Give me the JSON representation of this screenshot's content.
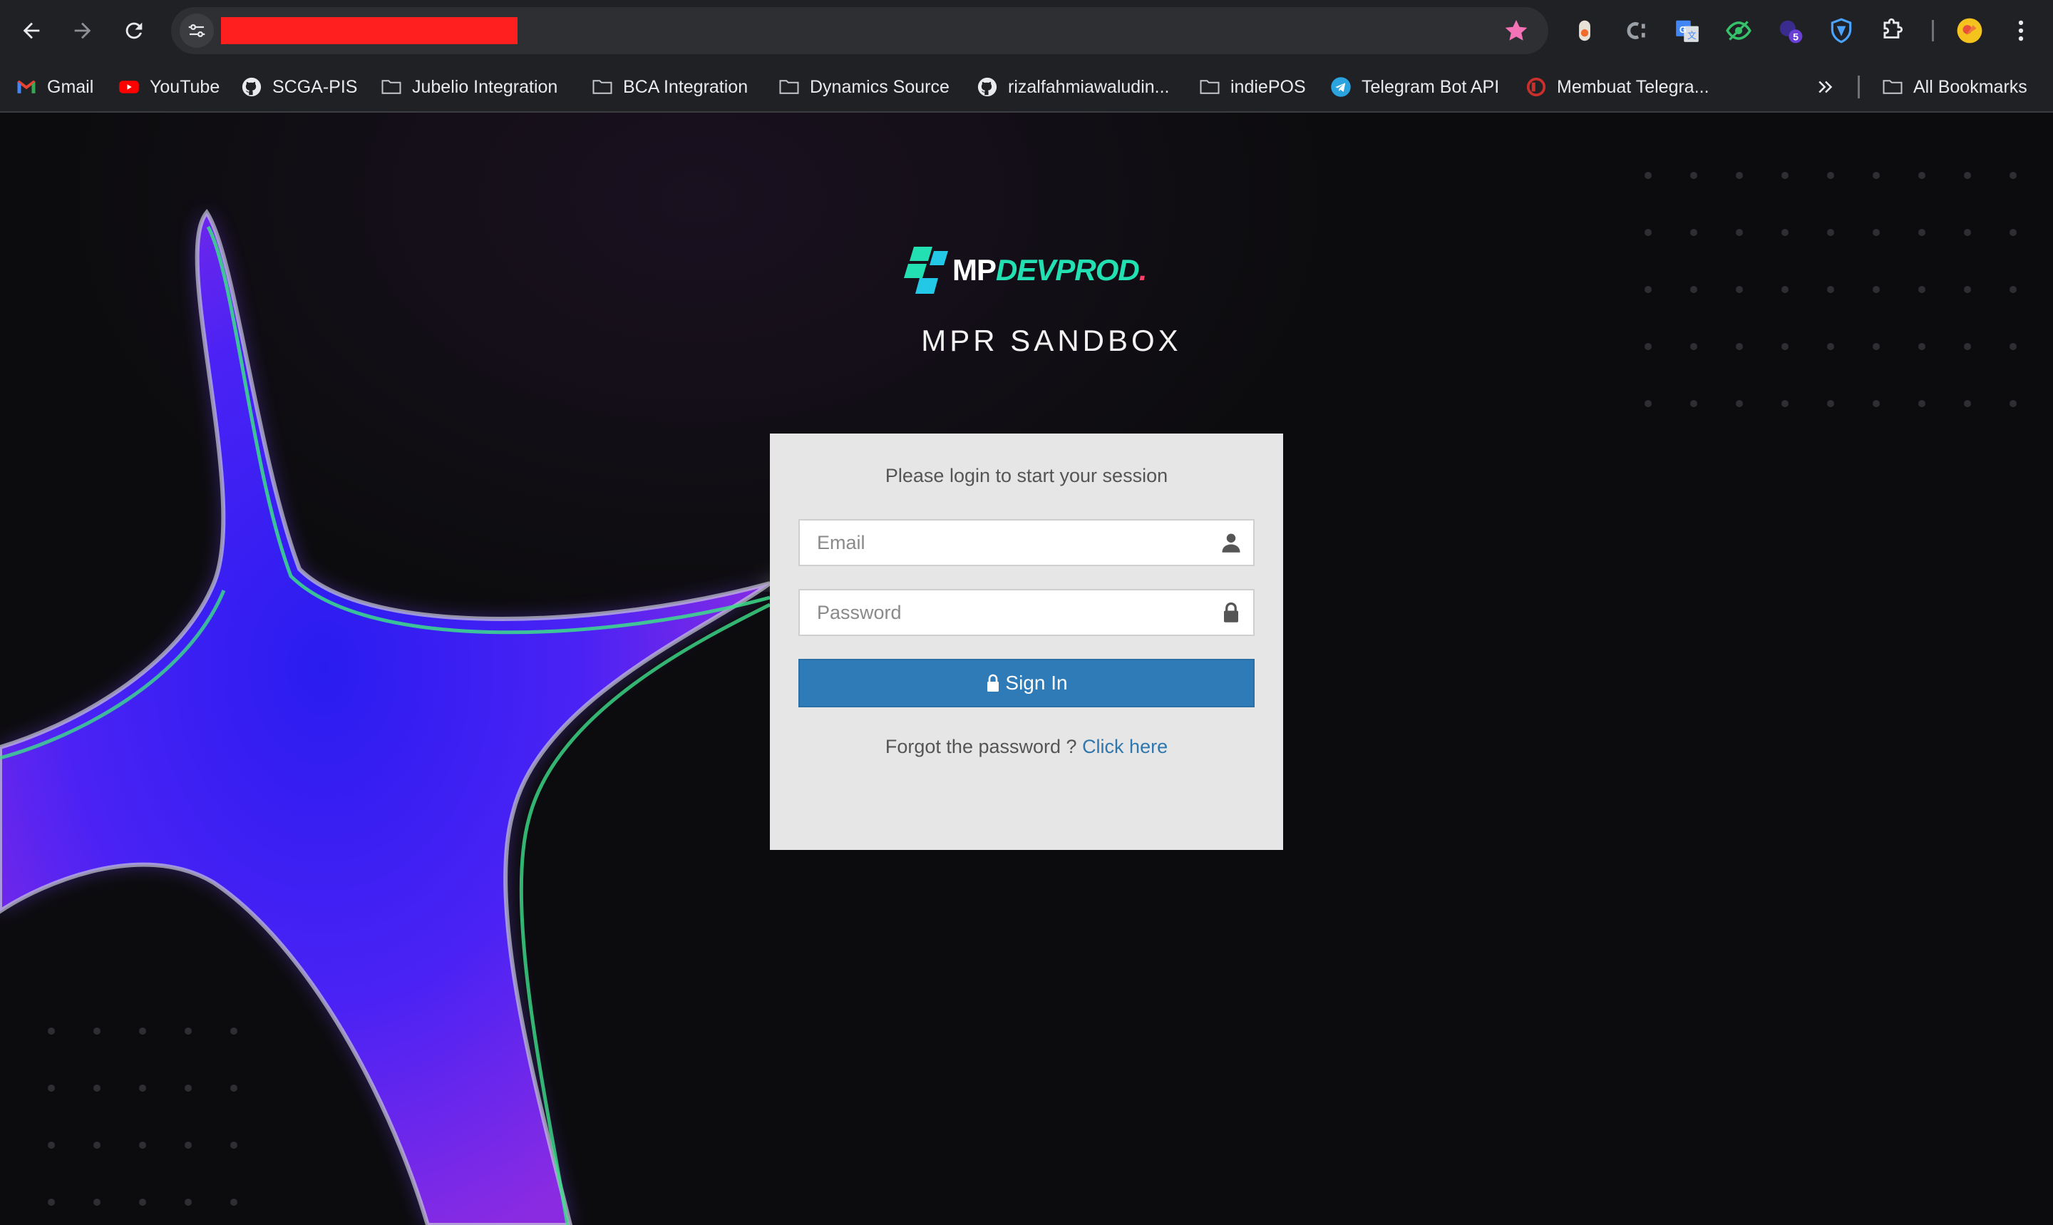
{
  "browser": {
    "back_icon": "arrow-left-icon",
    "forward_icon": "arrow-right-icon",
    "reload_icon": "reload-icon",
    "site_info_icon": "tune-icon",
    "bookmark_star_icon": "star-icon",
    "extensions": [
      "extension-orange-icon",
      "extension-c-icon",
      "google-translate-icon",
      "extension-eye-icon",
      "extension-badge-icon",
      "shield-icon",
      "puzzle-icon"
    ],
    "extension_badge_count": "5",
    "accent_star_color": "#f472b6"
  },
  "bookmarks": {
    "items": [
      {
        "label": "Gmail",
        "icon": "gmail-icon"
      },
      {
        "label": "YouTube",
        "icon": "youtube-icon"
      },
      {
        "label": "SCGA-PIS",
        "icon": "github-icon"
      },
      {
        "label": "Jubelio Integration",
        "icon": "folder-icon"
      },
      {
        "label": "BCA Integration",
        "icon": "folder-icon"
      },
      {
        "label": "Dynamics Source",
        "icon": "folder-icon"
      },
      {
        "label": "rizalfahmiawaludin...",
        "icon": "github-icon"
      },
      {
        "label": "indiePOS",
        "icon": "folder-icon"
      },
      {
        "label": "Telegram Bot API",
        "icon": "telegram-icon"
      },
      {
        "label": "Membuat Telegra...",
        "icon": "site-icon"
      }
    ],
    "overflow_icon": "chevron-double-right-icon",
    "all_bookmarks": "All Bookmarks"
  },
  "page": {
    "logo": {
      "mp": "MP",
      "dev": "DEVPROD",
      "dot": "."
    },
    "title": "MPR SANDBOX",
    "login": {
      "message": "Please login to start your session",
      "email_placeholder": "Email",
      "password_placeholder": "Password",
      "signin_label": "Sign In",
      "forgot_text": "Forgot the password ?",
      "forgot_link": "Click here"
    },
    "colors": {
      "signin": "#2e7bb8",
      "link": "#2f77ad",
      "logo_accent": "#22e0b2"
    }
  }
}
